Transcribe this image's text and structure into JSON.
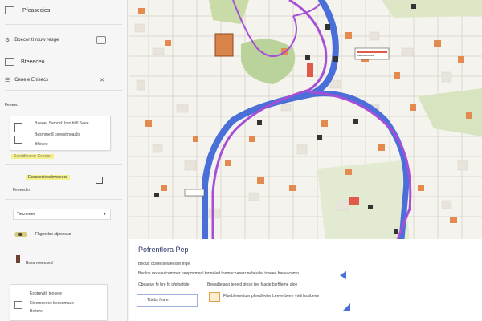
{
  "sidebar": {
    "header_title": "Pfeasecies",
    "section1_label": "Boecer ti rouw resge",
    "section2_title": "Bteeeceo",
    "filter_label": "Cenele Enisecs",
    "small_label": "Feeeec",
    "card1": {
      "line1": "Baeeer Samcel: Imo bbll Seee",
      "line2": "Besmmedl ceeestmoaalis",
      "line3": "Bfcieee"
    },
    "highlight_text": "Soeddleeecr Ceeeter",
    "card2_label": "Esecoecieoelewdeeer",
    "card2_sub": "Feeeedlo",
    "dropdown_label": "Tiecoeeee",
    "item_label": "Fhgnetlsp stjnsnsuo",
    "small_item": "Boes reeeoked",
    "card3": {
      "line1": "Esptrewtlr teosete",
      "line2": "Eteemseeec bessumuue",
      "line3": "Beltere"
    }
  },
  "map": {
    "legend_label": "Feredooconsile"
  },
  "panel": {
    "title": "Pofrentlora Pep",
    "subtitle": "Beoud ocloteolelaeestel fnge",
    "desc_line": "Beoloe noceledcemmer beepmtmeol tenneled tonmecoaeerr nebeutlel tcaeee fueteacomo",
    "row_left": "Cbeaeue fe bre fo pfelnettde",
    "row_right": "Beeadtelaeg teeeld gtese fee fcacie bsrftleme aloe",
    "input_value": "Tttebs feare",
    "bottom_right": "Ftbebleeeetuer pfeedleeler Leeee beee vteli bssibeee"
  },
  "colors": {
    "accent_blue": "#4a6fd8",
    "route_purple": "#a64fd6",
    "highlight_yellow": "#f4f08a",
    "building_orange": "#e28a4f",
    "park_green": "#a9c97e"
  }
}
